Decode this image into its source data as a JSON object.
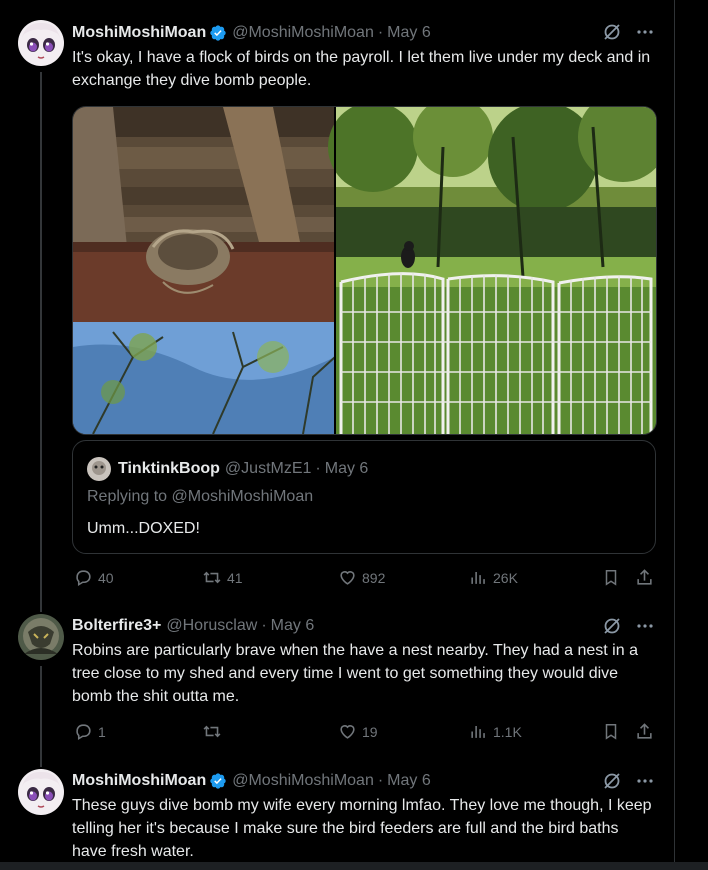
{
  "tweets": [
    {
      "name": "MoshiMoshiMoan",
      "handle": "@MoshiMoshiMoan",
      "separator": "·",
      "date": "May 6",
      "text": "It's okay, I have a flock of birds on the payroll.  I let them live under my deck and in exchange they dive bomb people.",
      "quote": {
        "name": "TinktinkBoop",
        "handle": "@JustMzE1",
        "separator": "·",
        "date": "May 6",
        "replying": "Replying to @MoshiMoshiMoan",
        "text": "Umm...DOXED!"
      },
      "stats": {
        "replies": "40",
        "reposts": "41",
        "likes": "892",
        "views": "26K"
      }
    },
    {
      "name": "Bolterfire3+",
      "handle": "@Horusclaw",
      "separator": "·",
      "date": "May 6",
      "text": "Robins are particularly brave when the have a nest nearby. They had a nest in a tree close to my shed and every time I went to get something they would dive bomb the shit outta me.",
      "stats": {
        "replies": "1",
        "reposts": "",
        "likes": "19",
        "views": "1.1K"
      }
    },
    {
      "name": "MoshiMoshiMoan",
      "handle": "@MoshiMoshiMoan",
      "separator": "·",
      "date": "May 6",
      "text": "These guys dive bomb my wife every morning lmfao.  They love me though, I keep telling her it's because I make sure the bird feeders are full and the bird baths have fresh water."
    }
  ],
  "colors": {
    "accent": "#1d9bf0",
    "muted": "#71767b",
    "text": "#e7e9ea",
    "border": "#2f3336"
  },
  "icons": [
    "verified-badge-icon",
    "grok-icon",
    "more-icon",
    "reply-icon",
    "repost-icon",
    "like-icon",
    "views-icon",
    "bookmark-icon",
    "share-icon"
  ]
}
